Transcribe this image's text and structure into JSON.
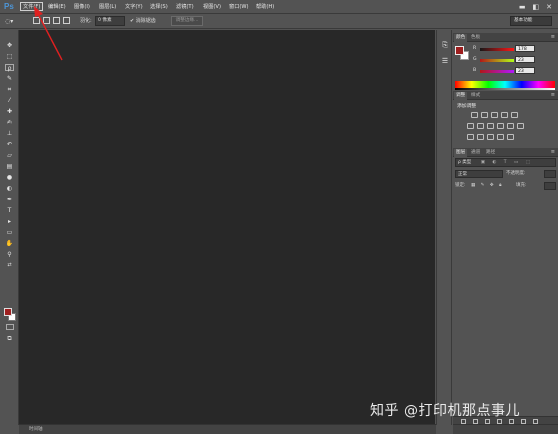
{
  "app": {
    "logo": "Ps"
  },
  "menu": {
    "items": [
      "文件(F)",
      "编辑(E)",
      "图像(I)",
      "图层(L)",
      "文字(Y)",
      "选择(S)",
      "滤镜(T)",
      "视图(V)",
      "窗口(W)",
      "帮助(H)"
    ]
  },
  "window_controls": {
    "minimize": "▬",
    "restore": "◧",
    "close": "✕"
  },
  "options": {
    "feather_label": "羽化:",
    "feather_value": "0 像素",
    "antialias_label": "消除锯齿",
    "refine_edge": "调整边缘...",
    "workspace": "基本功能"
  },
  "color_panel": {
    "tabs": [
      "颜色",
      "色板"
    ],
    "fg": "#9e1f1f",
    "bg": "#ffffff",
    "channels": [
      {
        "label": "R",
        "value": "178"
      },
      {
        "label": "G",
        "value": "23"
      },
      {
        "label": "B",
        "value": "23"
      }
    ]
  },
  "adjustments_panel": {
    "tabs": [
      "调整",
      "样式"
    ],
    "title": "添加调整"
  },
  "layers_panel": {
    "tabs": [
      "图层",
      "通道",
      "路径"
    ],
    "filter_label": "ρ 类型",
    "blend_mode": "正常",
    "opacity_label": "不透明度:",
    "lock_label": "锁定:",
    "fill_label": "填充:"
  },
  "statusbar": {
    "text": "时间轴"
  },
  "watermark": "知乎 @打印机那点事儿",
  "colors": {
    "canvas": "#282828",
    "ui": "#535353",
    "accent_arrow": "#e02020",
    "ps_blue": "#4d96d8"
  }
}
